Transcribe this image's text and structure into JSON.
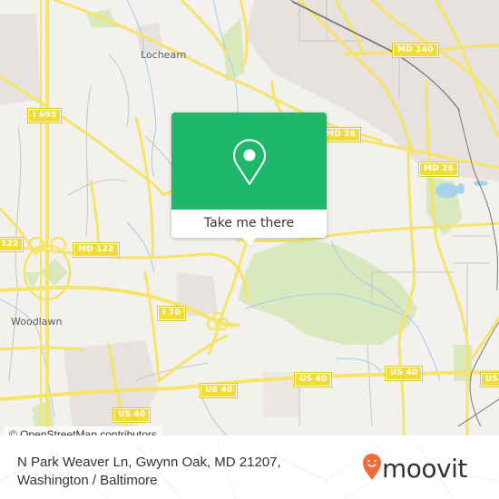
{
  "map": {
    "place_labels": [
      {
        "id": "lochearn",
        "text": "Lochearn"
      },
      {
        "id": "woodlawn",
        "text": "Woodlawn"
      }
    ],
    "road_shields": [
      {
        "id": "md140",
        "text": "MD 140"
      },
      {
        "id": "md26-upper",
        "text": "MD 26"
      },
      {
        "id": "md26-right",
        "text": "MD 26"
      },
      {
        "id": "i695",
        "text": "I 695"
      },
      {
        "id": "md122-left",
        "text": "122"
      },
      {
        "id": "md122",
        "text": "MD 122"
      },
      {
        "id": "i70",
        "text": "I 70"
      },
      {
        "id": "us40-left",
        "text": "US 40"
      },
      {
        "id": "us40-mid",
        "text": "US 40"
      },
      {
        "id": "us40-center",
        "text": "US 40"
      },
      {
        "id": "us40-right",
        "text": "US 40"
      },
      {
        "id": "us40-edge",
        "text": "US"
      }
    ],
    "colors": {
      "land": "#f2f1ed",
      "urban": "#e8e2de",
      "park": "#d9e9bd",
      "water": "#a7d3ea",
      "road_major": "#f6e469",
      "road_minor": "#c9c4c0",
      "rail": "#777777"
    }
  },
  "popup": {
    "icon": "location-pin-icon",
    "cta_label": "Take me there",
    "accent_color": "#1fb86b"
  },
  "attribution": "© OpenStreetMap contributors",
  "footer": {
    "address_line1": "N Park Weaver Ln, Gwynn Oak, MD 21207,",
    "address_line2": "Washington / Baltimore",
    "brand": "moovit",
    "brand_color": "#f26c3b"
  }
}
